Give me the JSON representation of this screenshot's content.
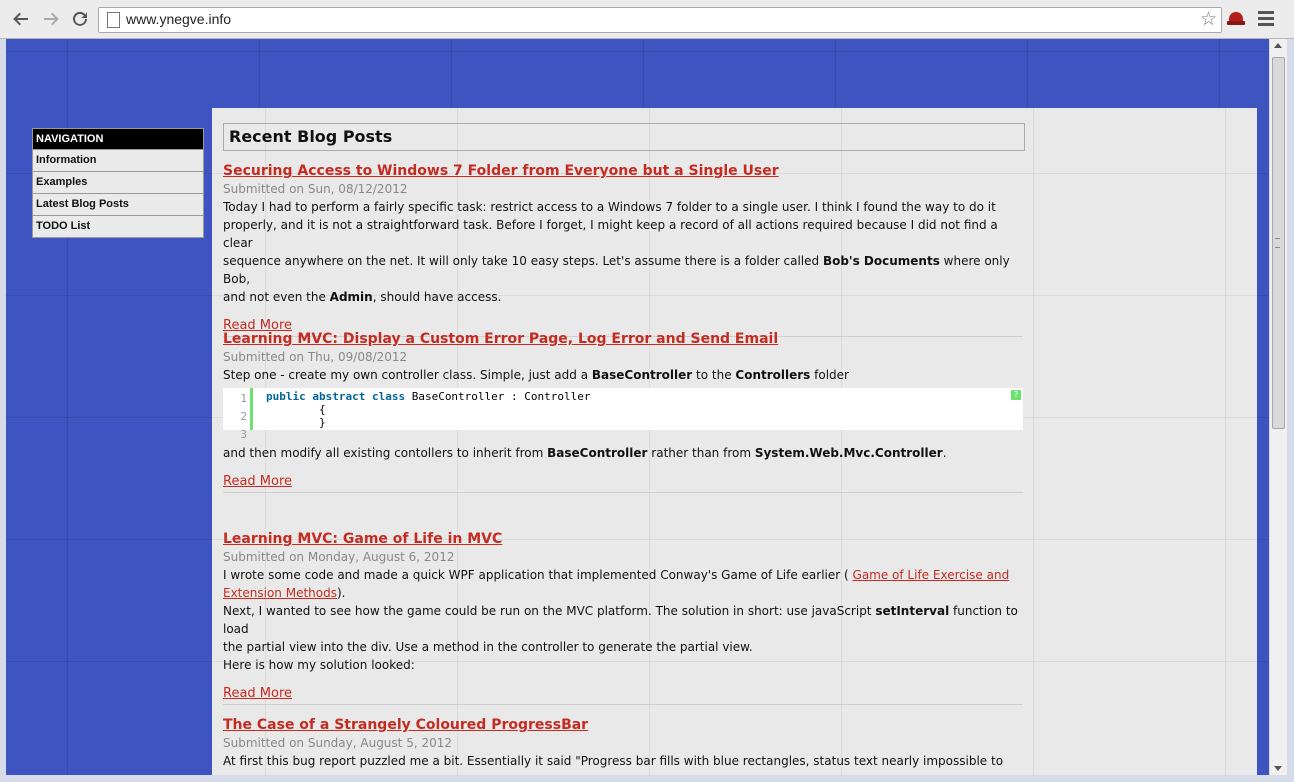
{
  "browser": {
    "url": "www.ynegve.info"
  },
  "sidebar": {
    "heading": "NAVIGATION",
    "items": [
      {
        "label": "Information"
      },
      {
        "label": "Examples"
      },
      {
        "label": "Latest Blog Posts"
      },
      {
        "label": "TODO List"
      }
    ]
  },
  "main": {
    "section_title": "Recent Blog Posts",
    "posts": [
      {
        "title": "Securing Access to Windows 7 Folder from Everyone but a Single User",
        "meta": "Submitted on Sun, 08/12/2012",
        "p1": "Today I had to perform a fairly specific task: restrict access to a Windows 7 folder to a single user. I think I found the way to do it",
        "p2": "properly, and it is not a straightforward task. Before I forget, I might keep a record of all actions required because I did not find a clear",
        "p3a": "sequence anywhere on the net. It will only take 10 easy steps. Let's assume there is a folder called ",
        "p3b": "Bob's Documents",
        "p3c": " where only Bob,",
        "p4a": "and not even the ",
        "p4b": "Admin",
        "p4c": ", should have access.",
        "read_more": "Read More"
      },
      {
        "title": "Learning MVC: Display a Custom Error Page, Log Error and Send Email",
        "meta": "Submitted on Thu, 09/08/2012",
        "p1a": "Step one - create my own controller class. Simple, just add a ",
        "p1b": "BaseController",
        "p1c": " to the ",
        "p1d": "Controllers",
        "p1e": " folder",
        "code": {
          "line_numbers": [
            "1",
            "2",
            "3"
          ],
          "kw": "public abstract class",
          "line1_rest": " BaseController : Controller",
          "line2": "        {",
          "line3": "        }",
          "help": "?"
        },
        "p2a": "and then modify all existing contollers to inherit from ",
        "p2b": "BaseController",
        "p2c": " rather than from ",
        "p2d": "System.Web.Mvc.Controller",
        "p2e": ".",
        "read_more": "Read More"
      },
      {
        "title": "Learning MVC: Game of Life in MVC",
        "meta": "Submitted on Monday, August 6, 2012",
        "p1a": "I wrote some code and made a quick WPF application that implemented Conway's Game of Life earlier ( ",
        "p1link1": "Game of Life Exercise and",
        "p1link2": "Extension Methods",
        "p1b": ").",
        "p2a": "Next, I wanted to see how the game could be run on the MVC platform. The solution in short: use javaScript ",
        "p2b": "setInterval",
        "p2c": " function to load",
        "p3": "the partial view into the div. Use a method in the controller to generate the partial view.",
        "p4": "Here is how my solution looked:",
        "read_more": "Read More"
      },
      {
        "title": "The Case of a Strangely Coloured ProgressBar",
        "meta": "Submitted on Sunday, August 5, 2012",
        "p1": "At first this bug report puzzled me a bit. Essentially it said \"Progress bar fills with blue rectangles, status text nearly impossible to"
      }
    ]
  }
}
